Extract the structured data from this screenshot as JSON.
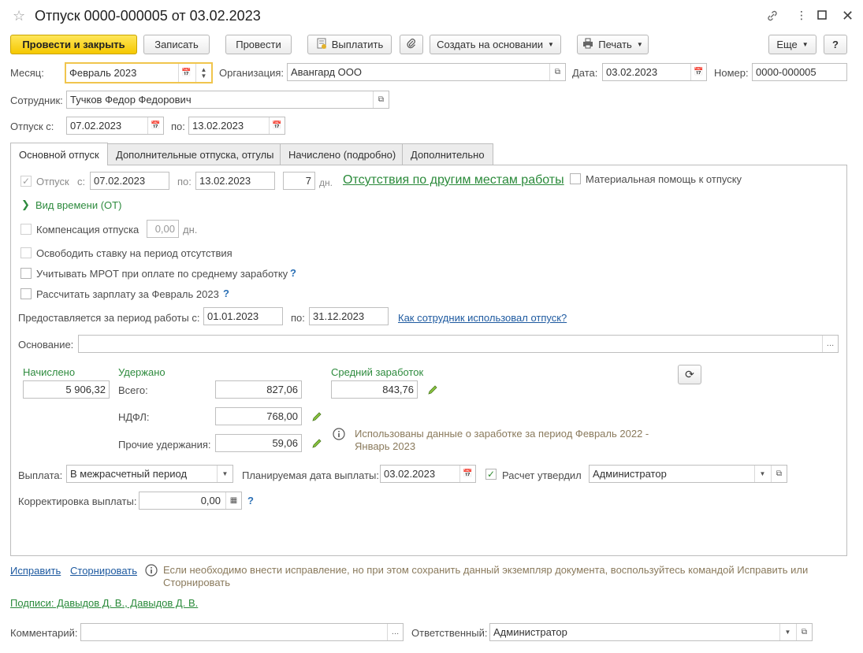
{
  "window": {
    "title": "Отпуск 0000-000005 от 03.02.2023"
  },
  "toolbar": {
    "post_close": "Провести и закрыть",
    "save": "Записать",
    "post": "Провести",
    "pay": "Выплатить",
    "create_based": "Создать на основании",
    "print": "Печать",
    "more": "Еще",
    "help": "?"
  },
  "header": {
    "month_label": "Месяц:",
    "month_value": "Февраль 2023",
    "org_label": "Организация:",
    "org_value": "Авангард ООО",
    "date_label": "Дата:",
    "date_value": "03.02.2023",
    "number_label": "Номер:",
    "number_value": "0000-000005",
    "employee_label": "Сотрудник:",
    "employee_value": "Тучков Федор Федорович",
    "vac_from_label": "Отпуск с:",
    "vac_from_value": "07.02.2023",
    "vac_to_label": "по:",
    "vac_to_value": "13.02.2023"
  },
  "tabs": [
    {
      "label": "Основной отпуск",
      "active": true
    },
    {
      "label": "Дополнительные отпуска, отгулы",
      "active": false
    },
    {
      "label": "Начислено (подробно)",
      "active": false
    },
    {
      "label": "Дополнительно",
      "active": false
    }
  ],
  "main": {
    "vacation_label": "Отпуск",
    "from_label": "с:",
    "from_value": "07.02.2023",
    "to_label": "по:",
    "to_value": "13.02.2023",
    "days_value": "7",
    "days_unit": "дн.",
    "absence_link": "Отсутствия по другим местам работы",
    "material_aid": "Материальная помощь к отпуску",
    "time_type": "Вид времени (ОТ)",
    "compensation_label": "Компенсация отпуска",
    "compensation_value": "0,00",
    "compensation_unit": "дн.",
    "free_rate": "Освободить ставку на период отсутствия",
    "mrot": "Учитывать МРОТ при оплате по среднему заработку",
    "calc_salary": "Рассчитать зарплату за Февраль 2023",
    "period_label": "Предоставляется за период работы с:",
    "period_from": "01.01.2023",
    "period_to_label": "по:",
    "period_to": "31.12.2023",
    "usage_link": "Как сотрудник использовал отпуск?",
    "basis_label": "Основание:",
    "basis_value": "",
    "accrued_header": "Начислено",
    "accrued_value": "5 906,32",
    "withheld_header": "Удержано",
    "total_label": "Всего:",
    "total_value": "827,06",
    "ndfl_label": "НДФЛ:",
    "ndfl_value": "768,00",
    "other_label": "Прочие удержания:",
    "other_value": "59,06",
    "avg_header": "Средний заработок",
    "avg_value": "843,76",
    "info_text_1": "Использованы данные о заработке за период Февраль 2022 -",
    "info_text_2": "Январь 2023",
    "payout_label": "Выплата:",
    "payout_value": "В межрасчетный период",
    "planned_label": "Планируемая дата выплаты:",
    "planned_value": "03.02.2023",
    "approved_label": "Расчет утвердил",
    "approved_value": "Администратор",
    "correction_label": "Корректировка выплаты:",
    "correction_value": "0,00"
  },
  "footer": {
    "fix_link": "Исправить",
    "reverse_link": "Сторнировать",
    "hint_1": "Если необходимо внести исправление, но при этом сохранить данный экземпляр документа, воспользуйтесь командой Исправить или",
    "hint_2": "Сторнировать",
    "signatures": "Подписи: Давыдов Д. В., Давыдов Д. В.",
    "comment_label": "Комментарий:",
    "comment_value": "",
    "responsible_label": "Ответственный:",
    "responsible_value": "Администратор"
  }
}
